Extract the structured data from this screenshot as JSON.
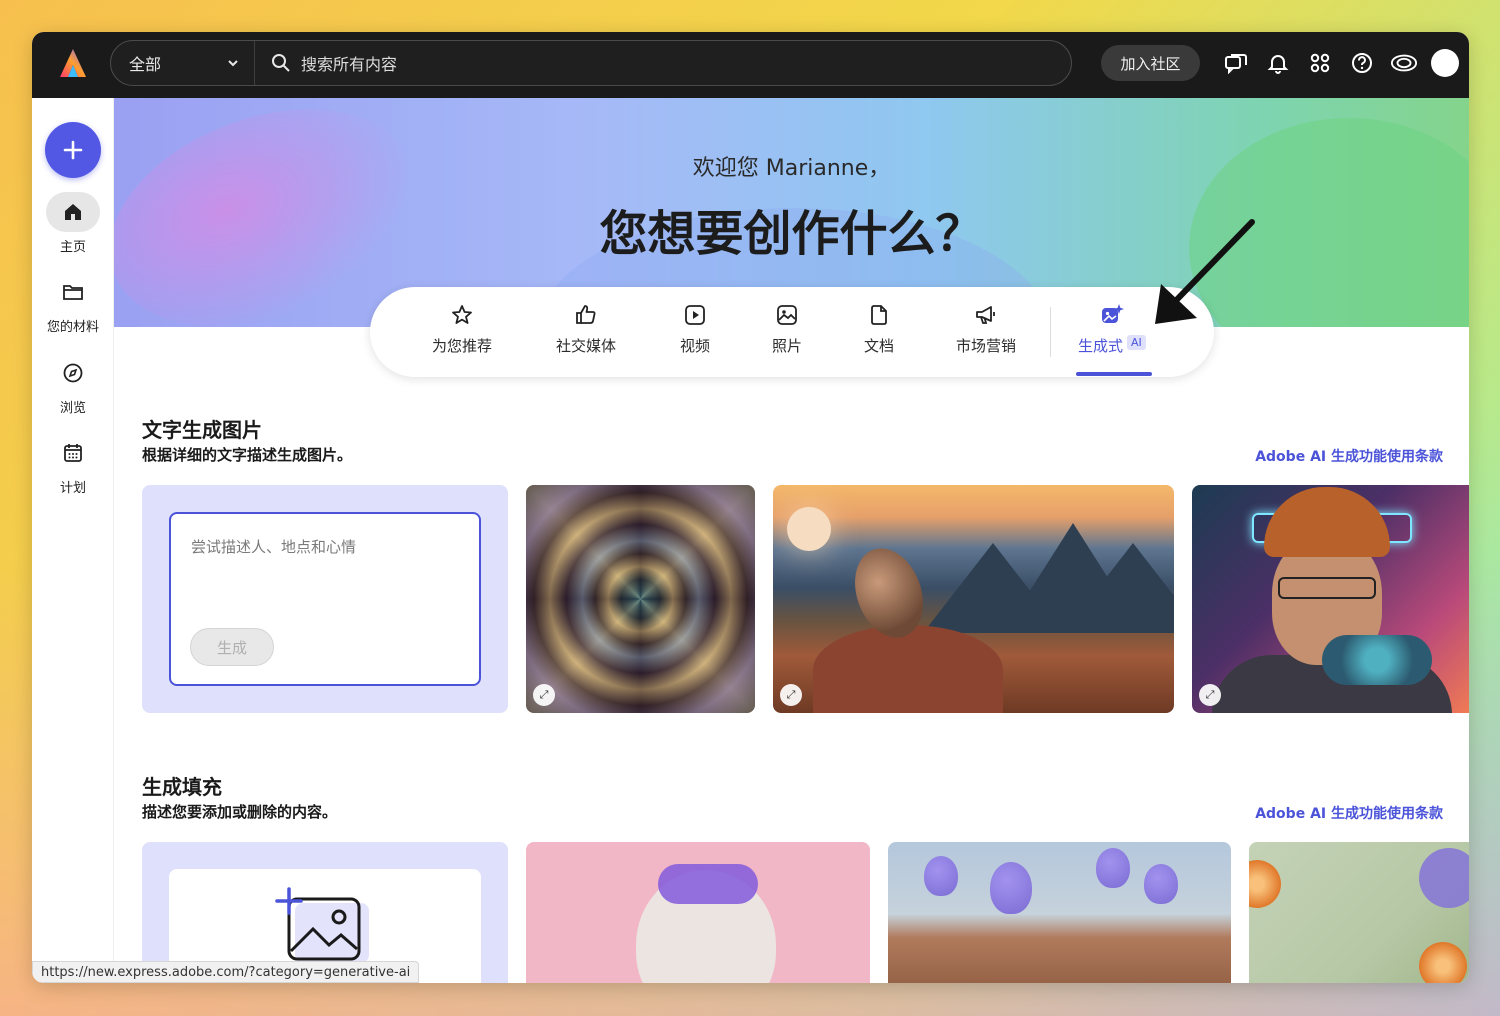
{
  "topbar": {
    "scope_label": "全部",
    "search_placeholder": "搜索所有内容",
    "join_label": "加入社区"
  },
  "rail": {
    "items": [
      {
        "label": "主页"
      },
      {
        "label": "您的材料"
      },
      {
        "label": "浏览"
      },
      {
        "label": "计划"
      }
    ]
  },
  "hero": {
    "welcome": "欢迎您 Marianne，",
    "title": "您想要创作什么？"
  },
  "tabs": [
    {
      "label": "为您推荐"
    },
    {
      "label": "社交媒体"
    },
    {
      "label": "视频"
    },
    {
      "label": "照片"
    },
    {
      "label": "文档"
    },
    {
      "label": "市场营销"
    },
    {
      "label": "生成式",
      "badge": "AI"
    }
  ],
  "section1": {
    "title": "文字生成图片",
    "subtitle": "根据详细的文字描述生成图片。",
    "link": "Adobe AI 生成功能使用条款",
    "prompt_placeholder": "尝试描述人、地点和心情",
    "generate_label": "生成"
  },
  "section2": {
    "title": "生成填充",
    "subtitle": "描述您要添加或删除的内容。",
    "link": "Adobe AI 生成功能使用条款"
  },
  "status_url": "https://new.express.adobe.com/?category=generative-ai",
  "colors": {
    "accent": "#4b53d9",
    "create_button": "#5258e4",
    "topbar": "#1a1a1a"
  }
}
